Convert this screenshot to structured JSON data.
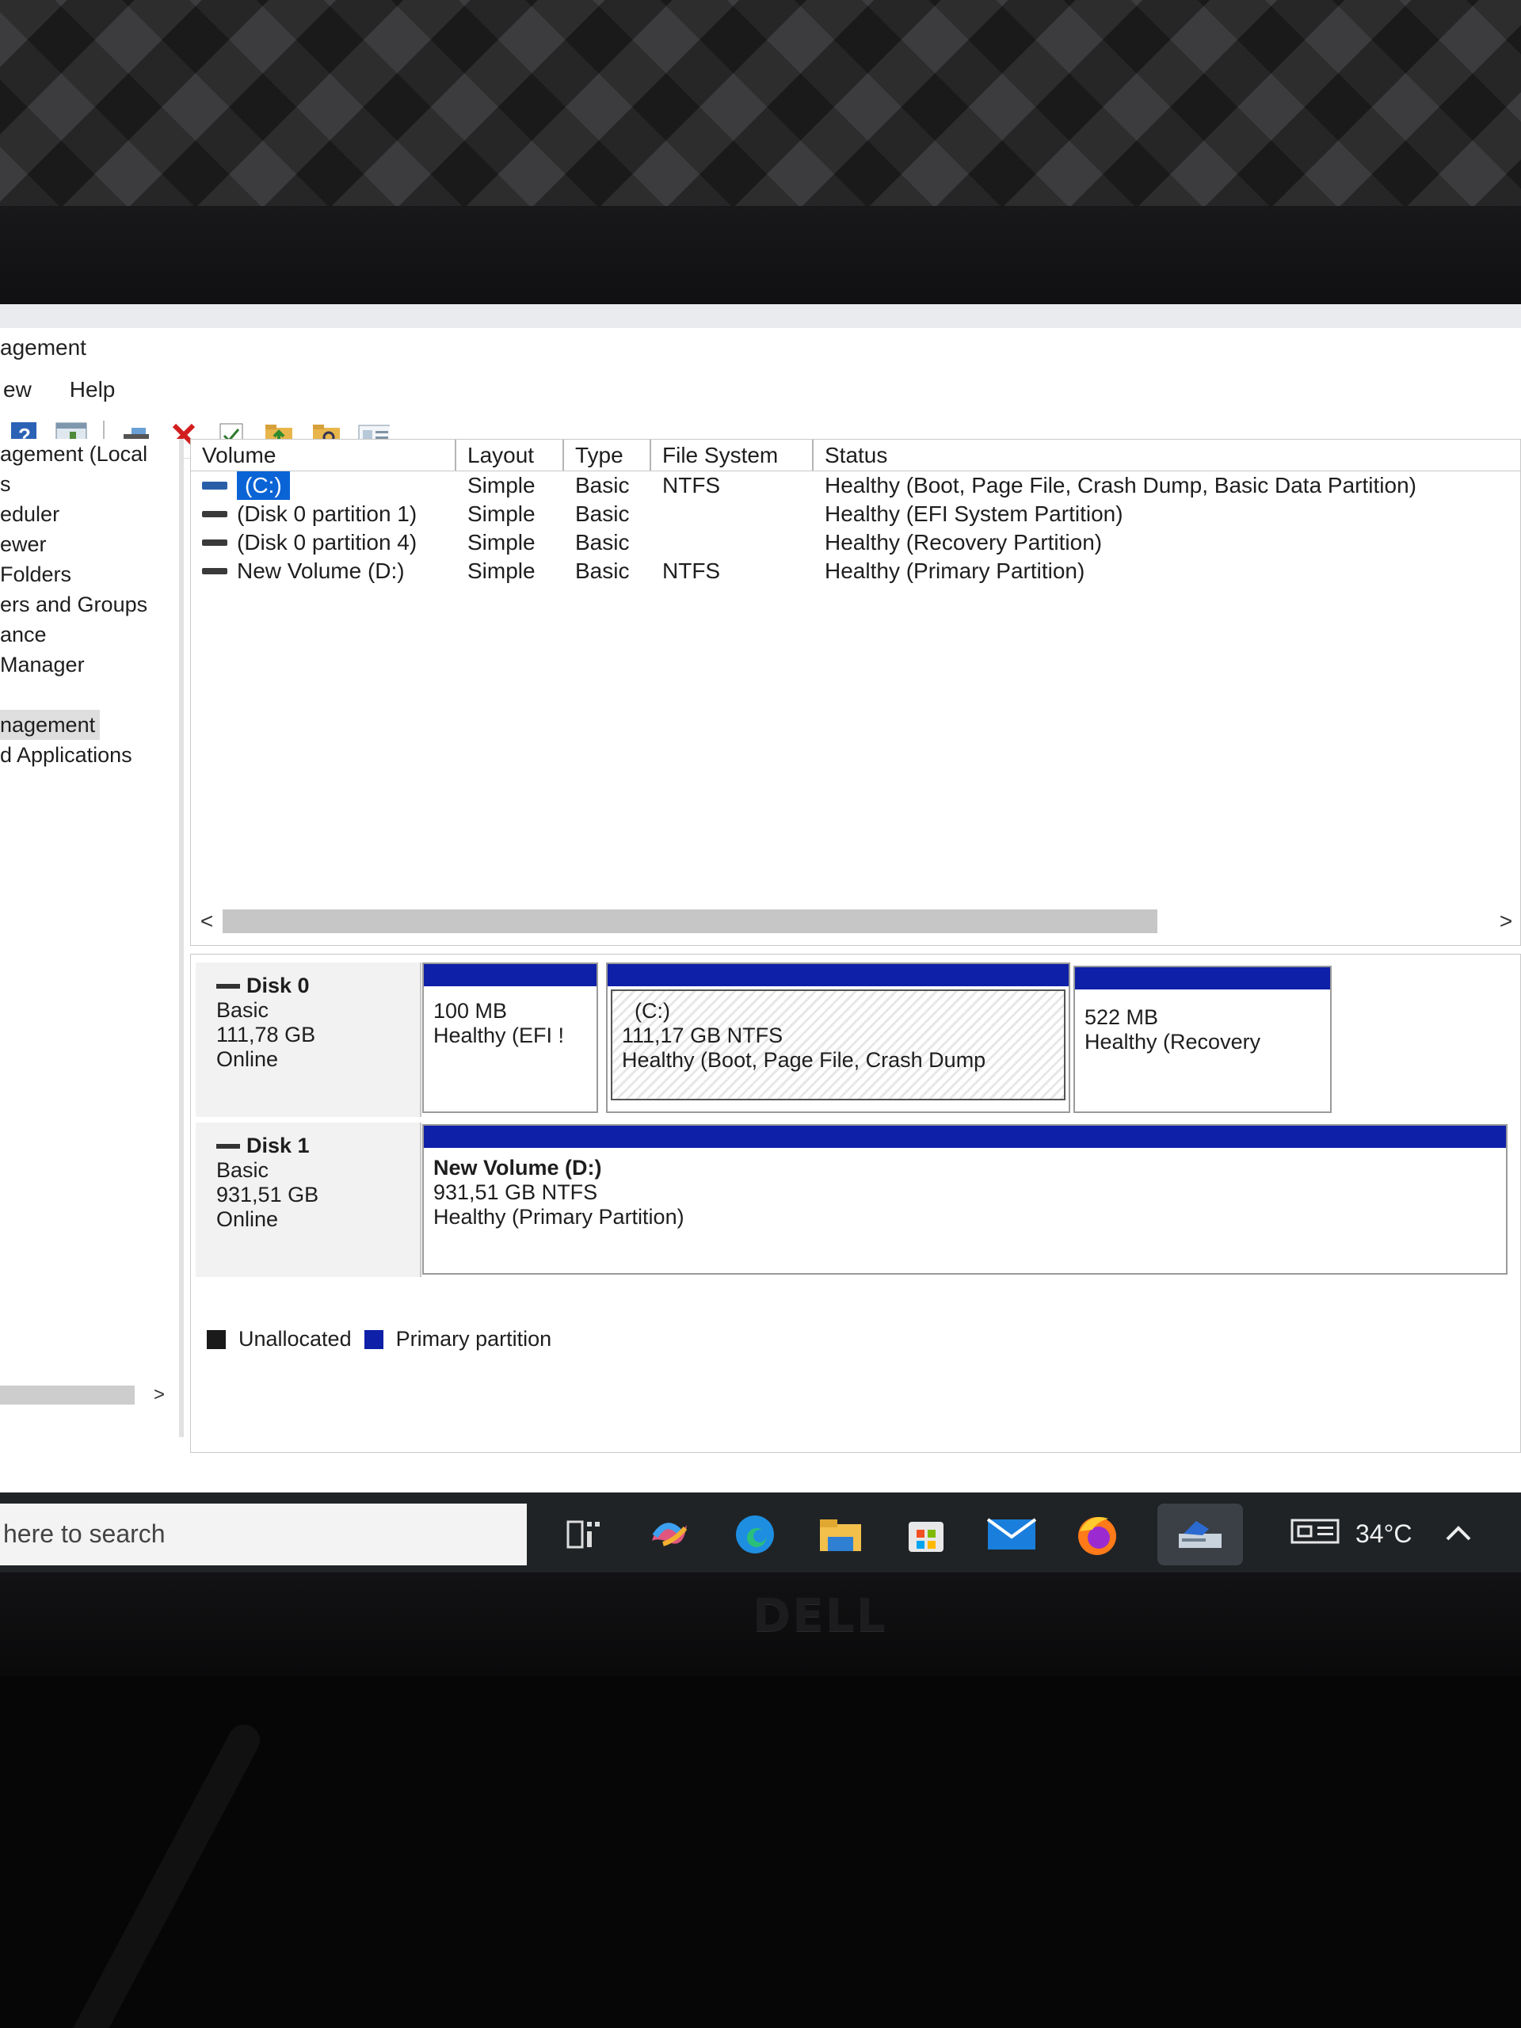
{
  "window": {
    "title": "agement"
  },
  "menu": {
    "items": [
      "ew",
      "Help"
    ]
  },
  "tree": {
    "items": [
      "agement (Local",
      "s",
      "eduler",
      "ewer",
      "Folders",
      "ers and Groups",
      "ance",
      "Manager",
      "",
      "nagement",
      "d Applications"
    ],
    "selected_index": 9
  },
  "volume_table": {
    "headers": [
      "Volume",
      "Layout",
      "Type",
      "File System",
      "Status"
    ],
    "rows": [
      {
        "volume": "(C:)",
        "layout": "Simple",
        "type": "Basic",
        "fs": "NTFS",
        "status": "Healthy (Boot, Page File, Crash Dump, Basic Data Partition)"
      },
      {
        "volume": "(Disk 0 partition 1)",
        "layout": "Simple",
        "type": "Basic",
        "fs": "",
        "status": "Healthy (EFI System Partition)"
      },
      {
        "volume": "(Disk 0 partition 4)",
        "layout": "Simple",
        "type": "Basic",
        "fs": "",
        "status": "Healthy (Recovery Partition)"
      },
      {
        "volume": "New Volume (D:)",
        "layout": "Simple",
        "type": "Basic",
        "fs": "NTFS",
        "status": "Healthy (Primary Partition)"
      }
    ],
    "scroll_left": "<",
    "scroll_right": ">"
  },
  "disks": [
    {
      "name": "Disk 0",
      "kind": "Basic",
      "size": "111,78 GB",
      "state": "Online",
      "partitions": [
        {
          "title": "",
          "line1": "100 MB",
          "line2": "Healthy (EFI !"
        },
        {
          "title": "(C:)",
          "line1": "111,17 GB NTFS",
          "line2": "Healthy (Boot, Page File, Crash Dump"
        },
        {
          "title": "",
          "line1": "522 MB",
          "line2": "Healthy (Recovery"
        }
      ]
    },
    {
      "name": "Disk 1",
      "kind": "Basic",
      "size": "931,51 GB",
      "state": "Online",
      "partitions": [
        {
          "title": "New Volume  (D:)",
          "line1": "931,51 GB NTFS",
          "line2": "Healthy (Primary Partition)"
        }
      ]
    }
  ],
  "legend": {
    "unallocated": "Unallocated",
    "primary": "Primary partition"
  },
  "colors": {
    "primary": "#0e1fa8",
    "unallocated": "#1a1a1a",
    "selection": "#0a64d6"
  },
  "tree_scroll_arrow": ">",
  "taskbar": {
    "search_text": "here to search",
    "weather_temp": "34°C",
    "icons": [
      "task-view-icon",
      "copilot-icon",
      "edge-icon",
      "file-explorer-icon",
      "store-icon",
      "mail-icon",
      "firefox-icon",
      "disk-management-icon"
    ]
  },
  "monitor_brand": "DELL"
}
